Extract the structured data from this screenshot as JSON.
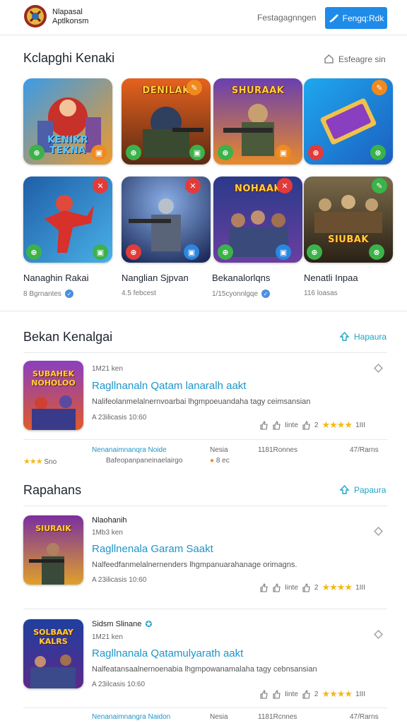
{
  "header": {
    "logo_line1": "Nlapasal",
    "logo_line2": "Aptlkonsm",
    "link": "Festagagnngen",
    "button_label": "Fengq:Rdk"
  },
  "section1": {
    "title": "Kclapghi Kenaki",
    "link": "Esfeagre sin",
    "cards": [
      {
        "tile_title": "KENIKR TEKNA",
        "name": "Nanaghin Rakai",
        "meta": "8 Bgrnantes"
      },
      {
        "tile_title": "DENILAK",
        "name": "Nanglian Sjpvan",
        "meta": "4.5 febcest"
      },
      {
        "tile_title": "SHURAAK",
        "name": "Bekanalorlqns",
        "meta": "1/15cyonnlgqe"
      },
      {
        "tile_title": "",
        "name": "Nenatli Inpaa",
        "meta": "116 loasas"
      },
      {
        "tile_title": "",
        "name": "",
        "meta": ""
      },
      {
        "tile_title": "",
        "name": "",
        "meta": ""
      },
      {
        "tile_title": "NOHAAK",
        "name": "",
        "meta": ""
      },
      {
        "tile_title": "SIUBAK",
        "name": "",
        "meta": ""
      }
    ]
  },
  "section2": {
    "title": "Bekan Kenalgai",
    "link": "Hapaura",
    "item": {
      "tile_title": "SUBAHEK NOHOLOO",
      "small": "1M21 ken",
      "title": "Ragllnanaln Qatam lanaralh aakt",
      "desc": "Nalifeolanmelalnernvoarbai lhgmpoeuandaha tagy ceimsansian",
      "stat": "A 23ilicasis 10:60",
      "action1": "Iinte",
      "action2": "2",
      "rating_count": "1III"
    },
    "footer": {
      "link": "Nenanaimnanqra Noide",
      "sub": "Bafeopanpaneinaelairgo",
      "stars_text": "Sno",
      "col1": "Nesia",
      "col1_sub": "8 ec",
      "col2": "1181Ronnes",
      "col3": "47/Rarns"
    }
  },
  "section3": {
    "title": "Rapahans",
    "link": "Papaura",
    "items": [
      {
        "tile_title": "SIURAIK",
        "author": "Nlaohanih",
        "small": "1Mb3 ken",
        "title": "Ragllnenala Garam Saakt",
        "desc": "Nalfeedfanmelalnernenders lhgmpanuarahanage orimagns.",
        "stat": "A 23ilicasis 10:60",
        "action1": "Iinte",
        "action2": "2",
        "rating_count": "1III"
      },
      {
        "tile_title": "SOLBAAY KALRS",
        "author": "Sidsm Slinane",
        "small": "1M21 ken",
        "title": "Ragllnanala Qatamulyarath aakt",
        "desc": "Nalfeatansaalnernoenabia lhgmpowanamalaha tagy cebnsansian",
        "stat": "A 23ilcasis 10:60",
        "action1": "Iinte",
        "action2": "2",
        "rating_count": "1III"
      }
    ],
    "footer": {
      "link": "Nenanaimnangra Naidon",
      "col1": "Nesia",
      "col2": "1181Rcnnes",
      "col3": "47/Rarns"
    }
  },
  "icons": {
    "logo": "shield-logo-icon",
    "header_button": "brush-icon",
    "section1_link": "home-icon",
    "section_link": "refresh-icon",
    "like": "thumbs-up-icon",
    "diamond": "diamond-icon",
    "verified": "verified-badge-icon"
  },
  "colors": {
    "accent": "#1f8be8",
    "link": "#1d95c9",
    "teal": "#1da5c2",
    "star": "#f5b815"
  }
}
